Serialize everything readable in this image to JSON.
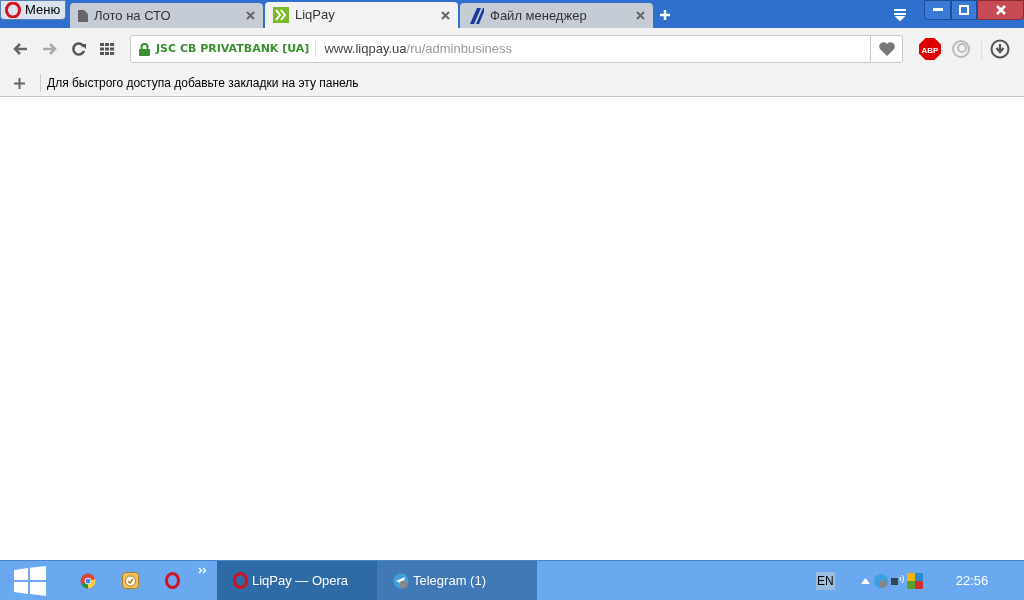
{
  "menu_button": {
    "label": "Меню"
  },
  "tabs": [
    {
      "kind": "page",
      "title": "Лото на СТО",
      "selected": false
    },
    {
      "kind": "liqpay",
      "title": "LiqPay",
      "selected": true
    },
    {
      "kind": "filemanager",
      "title": "Файл менеджер",
      "selected": false
    }
  ],
  "address_bar": {
    "site_name": "JSC CB PRIVATBANK [UA]",
    "url_host": "www.liqpay.ua",
    "url_path": "/ru/adminbusiness"
  },
  "extensions": {
    "adblock_label": "ABP"
  },
  "bookmarks_bar": {
    "hint": "Для быстрого доступа добавьте закладки на эту панель"
  },
  "taskbar": {
    "tasks": [
      {
        "kind": "opera",
        "label": "LiqPay — Opera",
        "selected": true
      },
      {
        "kind": "telegram",
        "label": "Telegram (1)",
        "selected": false
      }
    ],
    "language": "EN",
    "clock": "22:56"
  }
}
